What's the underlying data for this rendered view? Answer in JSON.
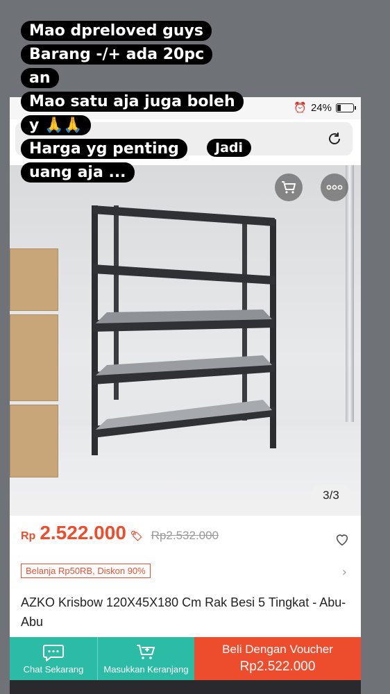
{
  "status": {
    "battery_text": "24%"
  },
  "gallery": {
    "counter": "3/3"
  },
  "product": {
    "currency": "Rp",
    "price": "2.522.000",
    "old_price": "Rp2.532.000",
    "promo_label": "Belanja Rp50RB, Diskon 90%",
    "title": "AZKO Krisbow 120X45X180 Cm Rak Besi 5 Tingkat - Abu-Abu"
  },
  "actions": {
    "chat_label": "Chat Sekarang",
    "cart_label": "Masukkan Keranjang",
    "buy_label": "Beli Dengan Voucher",
    "buy_price": "Rp2.522.000"
  },
  "caption": {
    "lines": [
      "Mao dpreloved guys",
      "Barang -/+ ada 20pc",
      "an",
      "Mao satu aja juga boleh",
      "y 🙏🙏",
      "Harga yg penting",
      "Jadi",
      "uang aja ..."
    ]
  },
  "colors": {
    "accent": "#ee4d2d",
    "teal": "#2cbca6"
  },
  "icons": [
    "reload-icon",
    "cart-icon",
    "more-icon",
    "heart-icon",
    "chat-icon",
    "add-cart-icon",
    "alarm-icon",
    "battery-icon",
    "voucher-icon",
    "chevron-right-icon"
  ]
}
